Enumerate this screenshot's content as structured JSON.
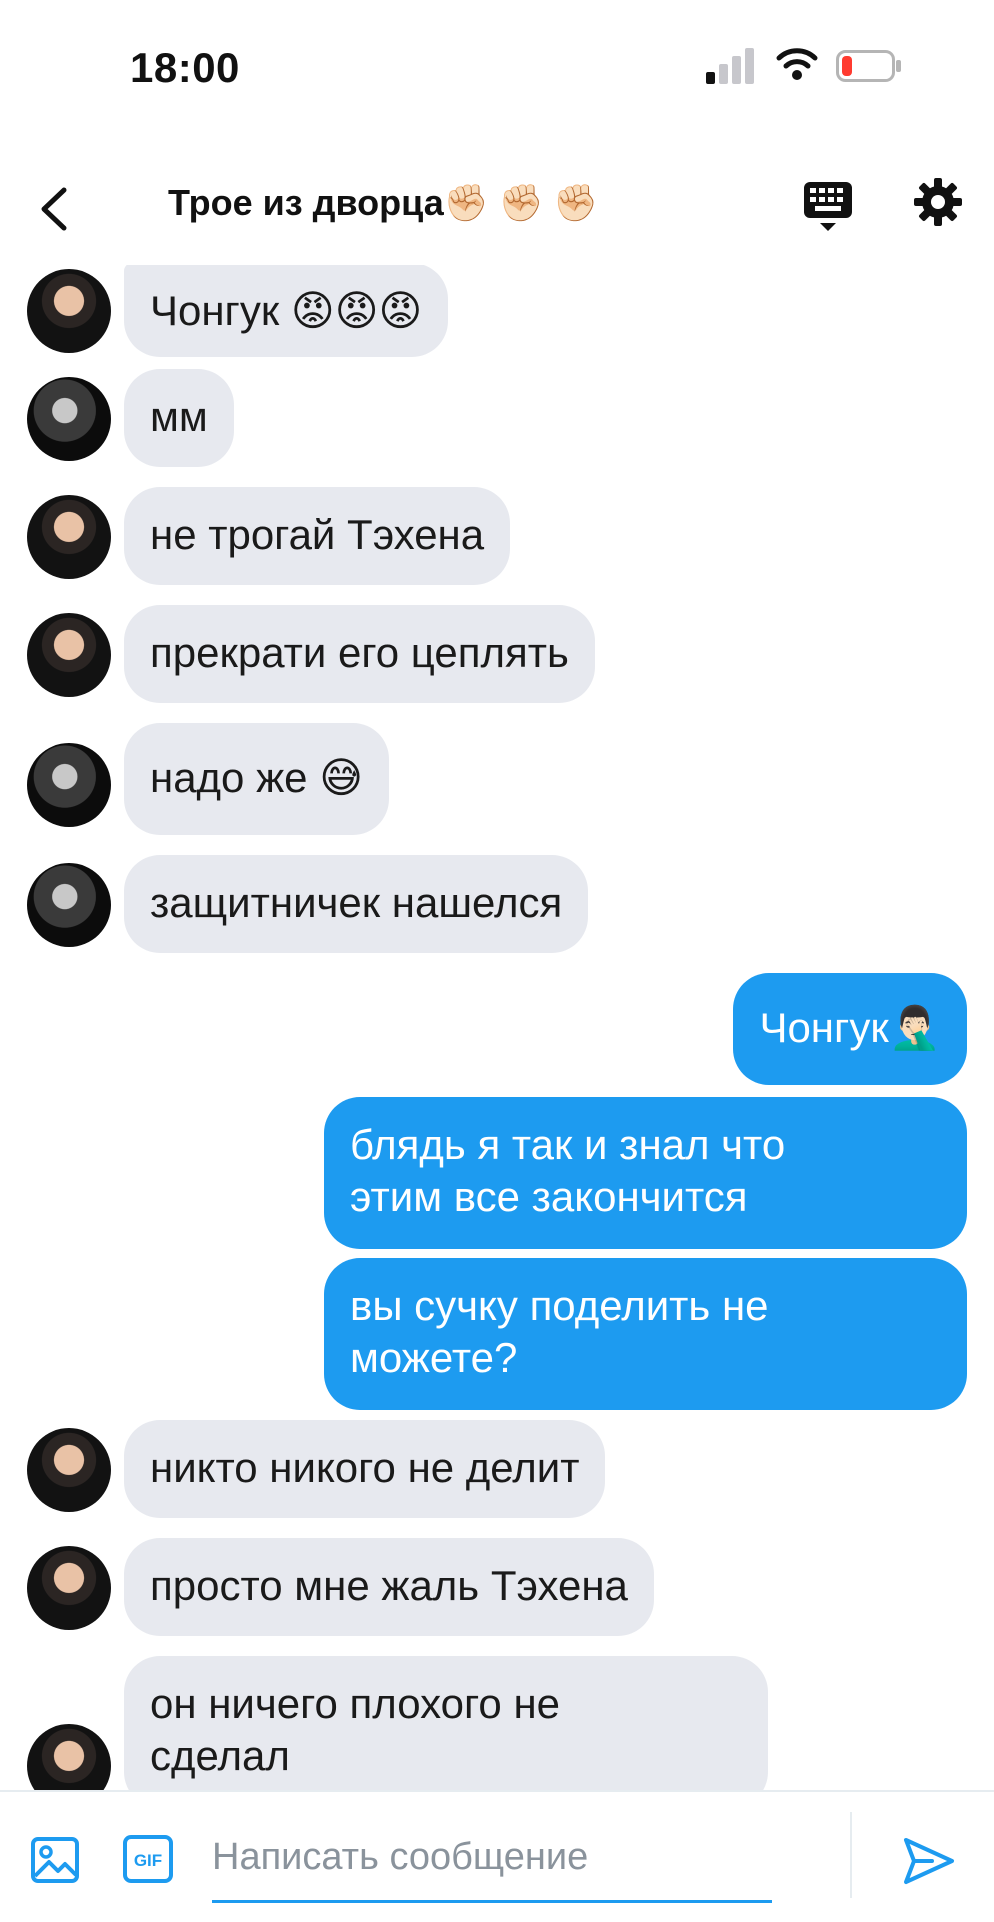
{
  "status_bar": {
    "time": "18:00"
  },
  "header": {
    "title": "Трое из дворца✊🏻 ✊🏻 ✊🏻"
  },
  "messages": [
    {
      "side": "in",
      "avatar": "a",
      "text": "Чонгук 😡😡😡"
    },
    {
      "side": "in",
      "avatar": "b",
      "text": "мм"
    },
    {
      "side": "in",
      "avatar": "a",
      "text": "не трогай Тэхена"
    },
    {
      "side": "in",
      "avatar": "a",
      "text": "прекрати его цеплять"
    },
    {
      "side": "in",
      "avatar": "b",
      "text": "надо же 😅"
    },
    {
      "side": "in",
      "avatar": "b",
      "text": "защитничек нашелся"
    },
    {
      "side": "out",
      "text": "Чонгук🤦🏻‍♂️"
    },
    {
      "side": "out",
      "text": "блядь я так и знал что\nэтим все закончится"
    },
    {
      "side": "out",
      "text": "вы сучку поделить не\nможете?"
    },
    {
      "side": "in",
      "avatar": "a",
      "text": "никто никого не делит"
    },
    {
      "side": "in",
      "avatar": "a",
      "text": "просто мне жаль Тэхена"
    },
    {
      "side": "in",
      "avatar": "a",
      "text": "он ничего плохого не\nсделал"
    }
  ],
  "composer": {
    "placeholder": "Написать сообщение",
    "gif_label": "GIF"
  },
  "icons": {
    "back": "chevron-left-icon",
    "keyboard": "keyboard-icon",
    "settings": "gear-icon",
    "image": "image-icon",
    "gif": "gif-icon",
    "send": "send-icon"
  },
  "colors": {
    "accent": "#1d9bf0",
    "incoming_bubble": "#e7e9ef",
    "battery_low": "#ff3b30"
  }
}
